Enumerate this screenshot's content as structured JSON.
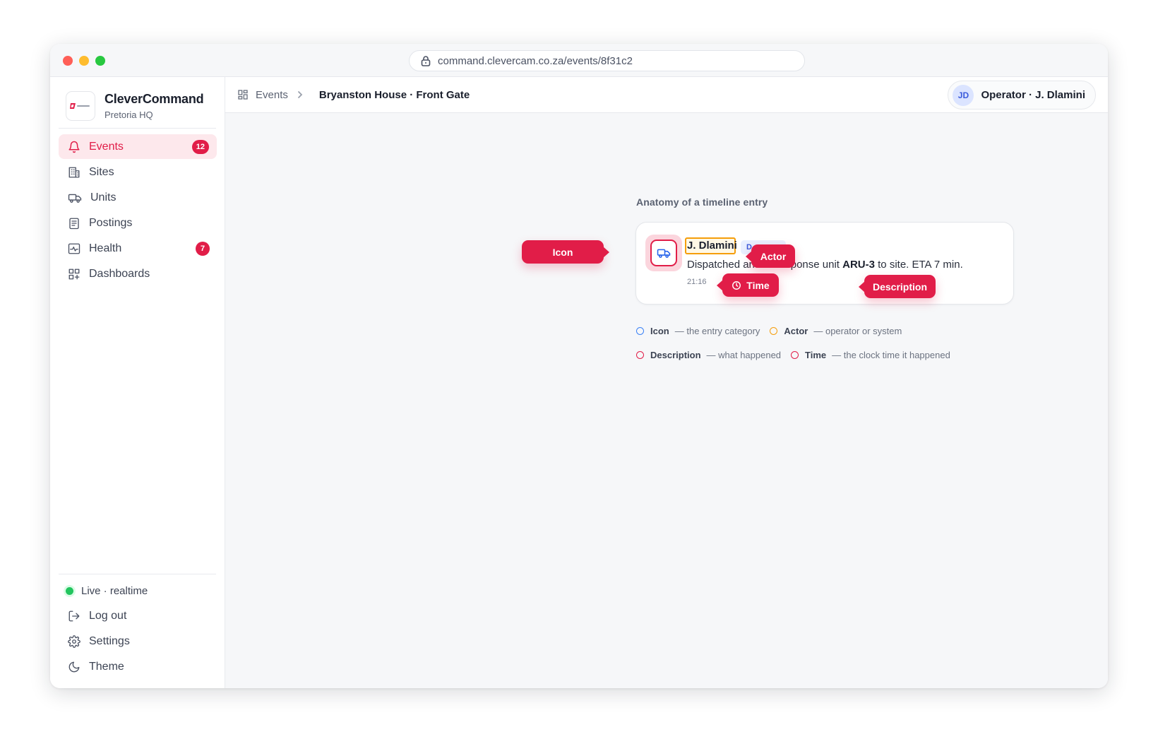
{
  "browser": {
    "url": "command.clevercam.co.za/events/8f31c2"
  },
  "brand": {
    "name": "CleverCommand",
    "location": "Pretoria HQ"
  },
  "sidebar": {
    "items": [
      {
        "label": "Events",
        "icon": "bell-icon",
        "badge": "12",
        "active": true
      },
      {
        "label": "Sites",
        "icon": "building-icon"
      },
      {
        "label": "Units",
        "icon": "truck-icon"
      },
      {
        "label": "Postings",
        "icon": "clipboard-icon"
      },
      {
        "label": "Health",
        "icon": "activity-icon",
        "badge": "7"
      },
      {
        "label": "Dashboards",
        "icon": "dashboard-icon"
      }
    ],
    "footer": {
      "status": "Live · realtime",
      "logout": "Log out",
      "settings": "Settings",
      "theme": "Theme"
    }
  },
  "header": {
    "breadcrumb_root": "Events",
    "breadcrumb_current": "Bryanston House · Front Gate",
    "user_initials": "JD",
    "user_label": "Operator · J. Dlamini"
  },
  "anatomy": {
    "title": "Anatomy of a timeline entry",
    "entry": {
      "actor": "J. Dlamini",
      "role_chip": "D",
      "description_prefix": "Dispatched armed response unit ",
      "description_unit": "ARU-3",
      "description_suffix": " to site. ETA 7 min.",
      "time": "21:16"
    },
    "tags": {
      "icon": "Icon",
      "actor": "Actor",
      "time": "Time",
      "description": "Description"
    },
    "legend": [
      {
        "key": "Icon",
        "text": "— the entry category",
        "color": "#3b82f6"
      },
      {
        "key": "Actor",
        "text": "— operator or system",
        "color": "#f59e0b"
      },
      {
        "key": "Description",
        "text": "— what happened",
        "color": "#e11d48"
      },
      {
        "key": "Time",
        "text": "— the clock time it happened",
        "color": "#e11d48"
      }
    ]
  },
  "colors": {
    "accent": "#e11d48",
    "live": "#22c55e",
    "actor_highlight": "#f59e0b"
  }
}
